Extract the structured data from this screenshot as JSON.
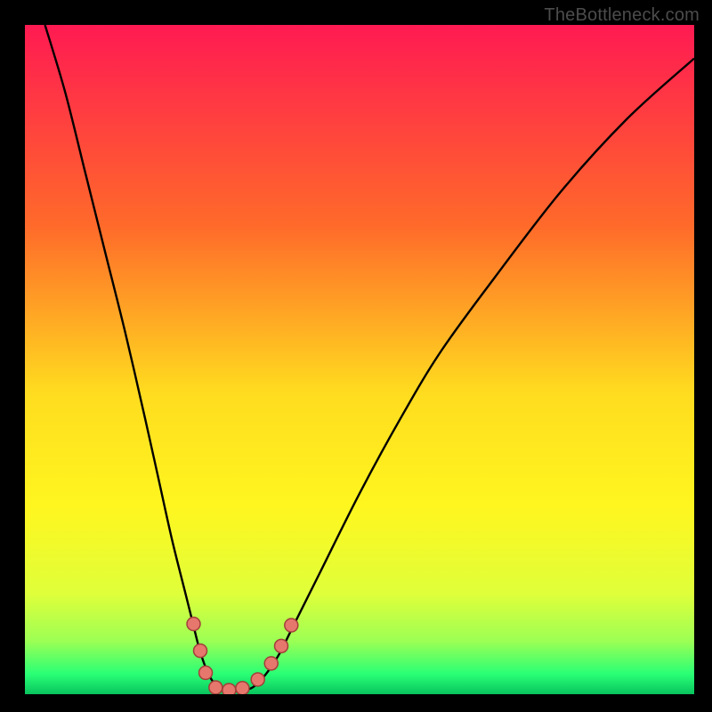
{
  "watermark": "TheBottleneck.com",
  "chart_data": {
    "type": "line",
    "title": "",
    "xlabel": "",
    "ylabel": "",
    "xlim": [
      0,
      100
    ],
    "ylim": [
      0,
      100
    ],
    "gradient_stops": [
      {
        "offset": 0,
        "color": "#ff1a52"
      },
      {
        "offset": 30,
        "color": "#ff6a2a"
      },
      {
        "offset": 55,
        "color": "#ffdc1f"
      },
      {
        "offset": 72,
        "color": "#fff61f"
      },
      {
        "offset": 85,
        "color": "#dfff3a"
      },
      {
        "offset": 92,
        "color": "#9dff54"
      },
      {
        "offset": 97,
        "color": "#29ff75"
      },
      {
        "offset": 100,
        "color": "#08c45e"
      }
    ],
    "series": [
      {
        "name": "bottleneck-curve",
        "color": "#000000",
        "x": [
          3,
          6,
          9,
          12,
          15,
          18,
          20,
          22,
          24,
          25,
          26,
          27,
          28,
          29,
          30,
          31,
          32,
          34,
          36,
          38,
          40,
          44,
          50,
          56,
          62,
          70,
          80,
          90,
          100
        ],
        "y": [
          100,
          90,
          78,
          66,
          54,
          41,
          32,
          23,
          15,
          11,
          7,
          4,
          2,
          1,
          0.5,
          0.5,
          0.5,
          1,
          3,
          6,
          10,
          18,
          30,
          41,
          51,
          62,
          75,
          86,
          95
        ]
      }
    ],
    "markers": {
      "color": "#e5776d",
      "stroke": "#a24039",
      "points": [
        {
          "x": 25.2,
          "y": 10.5
        },
        {
          "x": 26.2,
          "y": 6.5
        },
        {
          "x": 27.0,
          "y": 3.2
        },
        {
          "x": 28.5,
          "y": 1.0
        },
        {
          "x": 30.5,
          "y": 0.6
        },
        {
          "x": 32.5,
          "y": 0.9
        },
        {
          "x": 34.8,
          "y": 2.2
        },
        {
          "x": 36.8,
          "y": 4.6
        },
        {
          "x": 38.3,
          "y": 7.2
        },
        {
          "x": 39.8,
          "y": 10.3
        }
      ]
    }
  }
}
